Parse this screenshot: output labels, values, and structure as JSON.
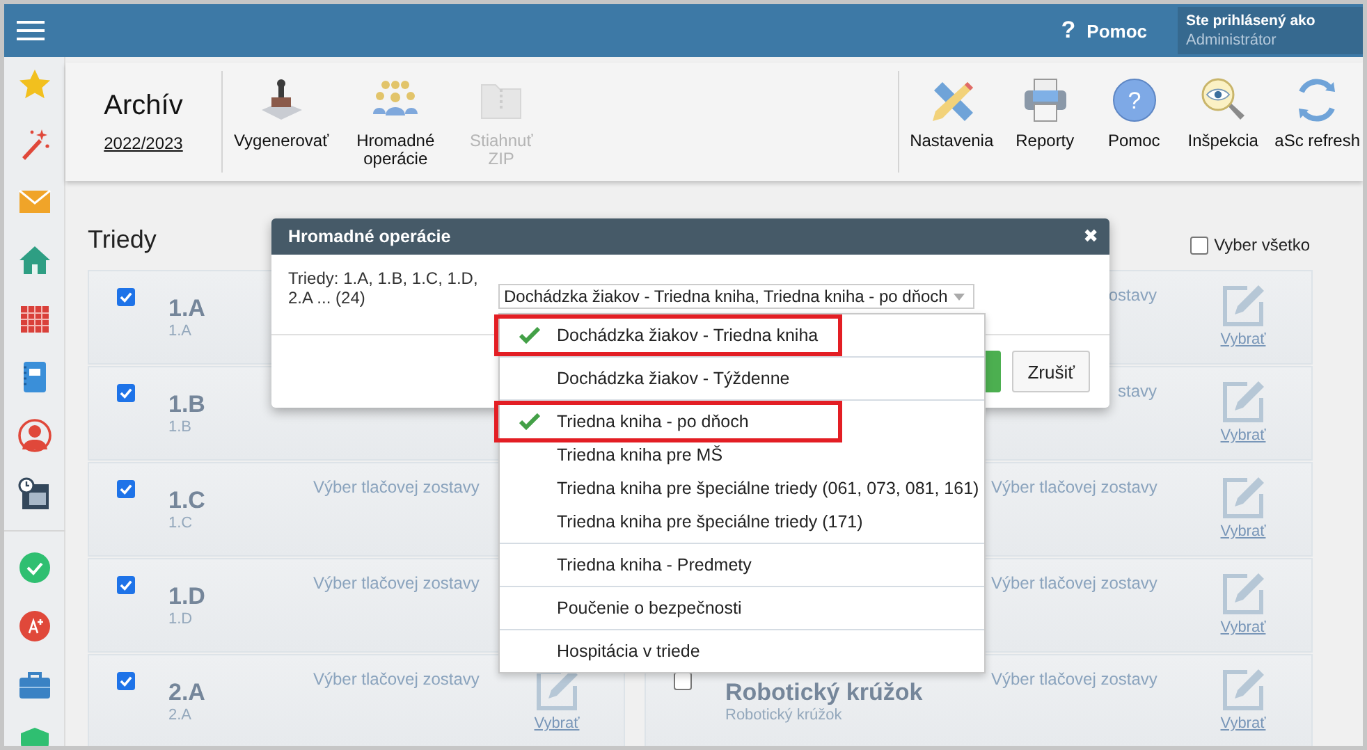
{
  "top_bar": {
    "help_icon": "?",
    "help_label": "Pomoc",
    "user_caption": "Ste prihlásený ako",
    "user_name": "Administrátor"
  },
  "header": {
    "title": "Archív",
    "year_link": "2022/2023"
  },
  "toolbar_left": [
    {
      "label": "Vygenerovať",
      "disabled": false
    },
    {
      "label": "Hromadné operácie",
      "disabled": false
    },
    {
      "label": "Stiahnuť ZIP",
      "disabled": true
    }
  ],
  "toolbar_right": [
    {
      "label": "Nastavenia"
    },
    {
      "label": "Reporty"
    },
    {
      "label": "Pomoc",
      "glyph": "?"
    },
    {
      "label": "Inšpekcia"
    },
    {
      "label": "aSc refresh"
    }
  ],
  "section": {
    "title": "Triedy",
    "select_all": {
      "label": "Vyber všetko",
      "checked": false
    }
  },
  "left_cards": [
    {
      "checked": true,
      "title": "1.A",
      "subtitle": "1.A"
    },
    {
      "checked": true,
      "title": "1.B",
      "subtitle": "1.B"
    },
    {
      "checked": true,
      "title": "1.C",
      "subtitle": "1.C",
      "report_link": "Výber tlačovej zostavy"
    },
    {
      "checked": true,
      "title": "1.D",
      "subtitle": "1.D",
      "report_link": "Výber tlačovej zostavy"
    },
    {
      "checked": true,
      "title": "2.A",
      "subtitle": "2.A",
      "report_link": "Výber tlačovej zostavy",
      "select_link": "Vybrať"
    }
  ],
  "right_cards": [
    {
      "report_link": "ostavy",
      "select_link": "Vybrať"
    },
    {
      "report_link": "stavy",
      "select_link": "Vybrať"
    },
    {
      "report_link": "Výber tlačovej zostavy",
      "select_link": "Vybrať"
    },
    {
      "report_link": "Výber tlačovej zostavy",
      "select_link": "Vybrať"
    },
    {
      "checked": false,
      "title": "Robotický krúžok",
      "subtitle": "Robotický krúžok",
      "report_link": "Výber tlačovej zostavy",
      "select_link": "Vybrať"
    }
  ],
  "dialog": {
    "title": "Hromadné operácie",
    "close": "✖",
    "summary": "Triedy: 1.A, 1.B, 1.C, 1.D, 2.A ... (24)",
    "select_value": "Dochádzka žiakov - Triedna kniha, Triedna kniha - po dňoch",
    "cancel": "Zrušiť"
  },
  "dropdown": {
    "groups": [
      [
        {
          "label": "Dochádzka žiakov - Triedna kniha",
          "checked": true,
          "highlighted": true
        }
      ],
      [
        {
          "label": "Dochádzka žiakov - Týždenne",
          "checked": false,
          "highlighted": false
        }
      ],
      [
        {
          "label": "Triedna kniha - po dňoch",
          "checked": true,
          "highlighted": true
        },
        {
          "label": "Triedna kniha pre MŠ",
          "checked": false,
          "highlighted": false
        },
        {
          "label": "Triedna kniha pre špeciálne triedy (061, 073, 081, 161)",
          "checked": false,
          "highlighted": false
        },
        {
          "label": "Triedna kniha pre špeciálne triedy (171)",
          "checked": false,
          "highlighted": false
        }
      ],
      [
        {
          "label": "Triedna kniha - Predmety",
          "checked": false,
          "highlighted": false
        }
      ],
      [
        {
          "label": "Poučenie o bezpečnosti",
          "checked": false,
          "highlighted": false
        }
      ],
      [
        {
          "label": "Hospitácia v triede",
          "checked": false,
          "highlighted": false
        }
      ]
    ]
  }
}
